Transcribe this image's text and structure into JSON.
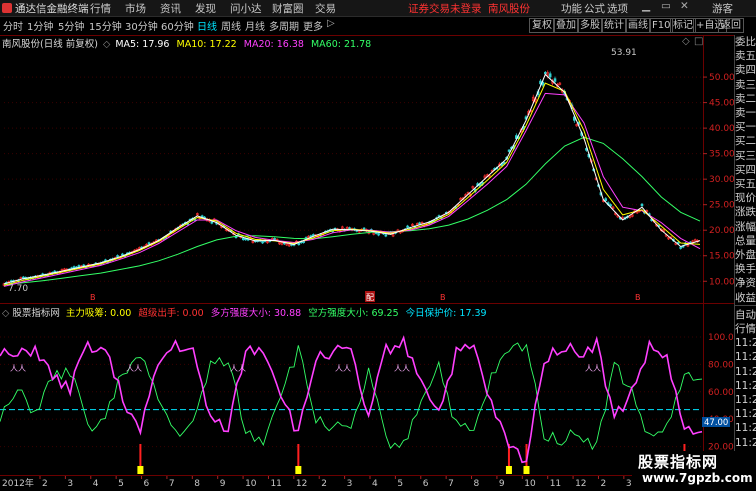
{
  "menu": {
    "app_title": "通达信金融终端",
    "items": [
      "行情",
      "市场",
      "资讯",
      "发现",
      "问小达",
      "财富圈",
      "交易"
    ],
    "login_notice": "证券交易未登录",
    "stock_link": "南风股份",
    "right_items": [
      "功能",
      "公式",
      "选项"
    ],
    "guest": "游客"
  },
  "timeframes": {
    "items": [
      "分时",
      "1分钟",
      "5分钟",
      "15分钟",
      "30分钟",
      "60分钟",
      "日线",
      "周线",
      "月线",
      "多周期",
      "更多"
    ],
    "active": "日线",
    "more_arrow": "▷",
    "right_buttons": [
      "复权",
      "叠加",
      "多股",
      "统计",
      "画线",
      "F10",
      "标记",
      "+自选",
      "返回"
    ]
  },
  "main": {
    "title": "南风股份(日线 前复权)",
    "ma": [
      {
        "label": "MA5: 17.96",
        "color": "#ffffff"
      },
      {
        "label": "MA10: 17.22",
        "color": "#ffff00"
      },
      {
        "label": "MA20: 16.38",
        "color": "#ff40ff"
      },
      {
        "label": "MA60: 21.78",
        "color": "#33ff66"
      }
    ],
    "y_ticks": [
      "50.00",
      "45.00",
      "40.00",
      "35.00",
      "30.00",
      "25.00",
      "20.00",
      "15.00",
      "10.00"
    ],
    "high_label": "53.91",
    "low_label": "7.70",
    "marker_bottom": [
      "B",
      "B",
      "B",
      "B"
    ],
    "marker_box": "配"
  },
  "indicator": {
    "title": "股票指标网",
    "items": [
      {
        "label": "主力吸筹:",
        "value": "0.00",
        "color": "#ffff00"
      },
      {
        "label": "超级出手:",
        "value": "0.00",
        "color": "#ff3232"
      },
      {
        "label": "多方强度大小:",
        "value": "30.88",
        "color": "#ff40ff"
      },
      {
        "label": "空方强度大小:",
        "value": "69.25",
        "color": "#33ff66"
      },
      {
        "label": "今日保护价:",
        "value": "17.39",
        "color": "#00e5ff"
      }
    ],
    "y_ticks": [
      "100.00",
      "80.00",
      "60.00",
      "40.00",
      "20.00"
    ],
    "current_value": "47.00",
    "signal_marks": "人人"
  },
  "xaxis": {
    "year_label": "2012年",
    "months": [
      "2",
      "3",
      "4",
      "5",
      "6",
      "7",
      "8",
      "9",
      "10",
      "11",
      "12",
      "2",
      "3",
      "4",
      "5",
      "6",
      "7",
      "8",
      "9",
      "10",
      "11",
      "12",
      "2",
      "3",
      "4",
      "5",
      "6"
    ]
  },
  "side_panel": [
    "委比",
    "卖五",
    "卖四",
    "卖三",
    "卖二",
    "卖一",
    "买一",
    "买二",
    "买三",
    "买四",
    "买五",
    "现价",
    "涨跌",
    "涨幅",
    "总量",
    "外盘",
    "换手",
    "净资",
    "收益",
    "",
    "自动",
    "行情",
    "11:2",
    "11:2",
    "11:2",
    "11:2",
    "11:2",
    "11:2",
    "11:2",
    "11:2",
    "11:2"
  ],
  "watermark": {
    "line1": "股票指标网",
    "line2": "www.7gpzb.com"
  },
  "chart_data": [
    {
      "type": "line",
      "title": "南风股份(日线 前复权)",
      "ylim": [
        7.7,
        53.91
      ],
      "y_ticks": [
        10,
        15,
        20,
        25,
        30,
        35,
        40,
        45,
        50
      ],
      "series": [
        {
          "name": "MA5",
          "color": "#ffffff",
          "values": [
            9.5,
            10.5,
            11.2,
            12,
            12.8,
            13.6,
            14.8,
            16.2,
            18,
            20.5,
            22.8,
            21.5,
            19,
            17.9,
            18,
            17.2,
            18.8,
            20.2,
            20.1,
            19.8,
            19.2,
            20.5,
            21.6,
            23.5,
            27,
            30.5,
            34,
            41.5,
            50.5,
            47,
            38,
            26,
            22,
            24.5,
            20,
            16.8,
            17.96
          ]
        },
        {
          "name": "MA10",
          "color": "#ffff00",
          "values": [
            9.2,
            10.2,
            11,
            11.8,
            12.6,
            13.4,
            14.6,
            16,
            17.8,
            20.2,
            22.5,
            21.8,
            19.4,
            18.2,
            17.9,
            17.4,
            18.5,
            19.9,
            20.2,
            19.9,
            19.4,
            20.2,
            21.3,
            23.1,
            26.4,
            29.8,
            33.3,
            40.5,
            48.8,
            47.2,
            39.5,
            28,
            23,
            24,
            20.8,
            17.5,
            17.22
          ]
        },
        {
          "name": "MA20",
          "color": "#ff40ff",
          "values": [
            9,
            9.9,
            10.7,
            11.5,
            12.3,
            13.1,
            14.3,
            15.6,
            17.4,
            19.7,
            22,
            22,
            19.9,
            18.6,
            18,
            17.6,
            18.2,
            19.5,
            20.1,
            20,
            19.6,
            20,
            21,
            22.7,
            25.8,
            29,
            32.5,
            39.5,
            46.8,
            46.5,
            41,
            30.5,
            24.5,
            23.8,
            21.5,
            18.4,
            16.38
          ]
        },
        {
          "name": "MA60",
          "color": "#33ff66",
          "values": [
            9.3,
            9.7,
            10.1,
            10.6,
            11.1,
            11.6,
            12.3,
            13,
            14,
            15.3,
            16.8,
            18.1,
            18.8,
            18.9,
            18.7,
            18.4,
            18.3,
            18.7,
            19.2,
            19.6,
            19.7,
            19.9,
            20.3,
            21,
            22.2,
            23.9,
            26,
            29,
            33,
            36.5,
            38.2,
            37,
            34,
            30.5,
            26.5,
            23.5,
            21.78
          ]
        }
      ]
    },
    {
      "type": "line",
      "title": "股票指标网",
      "ylim": [
        0,
        100
      ],
      "y_ticks": [
        20,
        40,
        60,
        80,
        100
      ],
      "series": [
        {
          "name": "多方强度大小",
          "color": "#ff40ff",
          "values": [
            88,
            85,
            92,
            70,
            62,
            95,
            90,
            55,
            30,
            80,
            95,
            88,
            40,
            35,
            90,
            92,
            60,
            28,
            85,
            90,
            88,
            40,
            92,
            95,
            70,
            45,
            88,
            92,
            50,
            20,
            10,
            85,
            93,
            88,
            95,
            40,
            60,
            92,
            85,
            30,
            30.88
          ]
        },
        {
          "name": "空方强度大小",
          "color": "#33ff66",
          "values": [
            40,
            60,
            45,
            70,
            75,
            35,
            40,
            75,
            85,
            55,
            30,
            35,
            80,
            85,
            30,
            25,
            60,
            90,
            40,
            35,
            30,
            75,
            25,
            20,
            55,
            80,
            35,
            30,
            70,
            90,
            95,
            30,
            25,
            30,
            20,
            80,
            60,
            25,
            35,
            70,
            69.25
          ]
        },
        {
          "name": "今日保护价",
          "color": "#00e5ff",
          "values": [
            47,
            47,
            47,
            47,
            47,
            47,
            47,
            47,
            47,
            47,
            47,
            47,
            47,
            47,
            47,
            47,
            47,
            47,
            47,
            47,
            47,
            47,
            47,
            47,
            47,
            47,
            47,
            47,
            47,
            47,
            47,
            47,
            47,
            47,
            47,
            47,
            47,
            47,
            47,
            47,
            47
          ]
        }
      ]
    }
  ]
}
